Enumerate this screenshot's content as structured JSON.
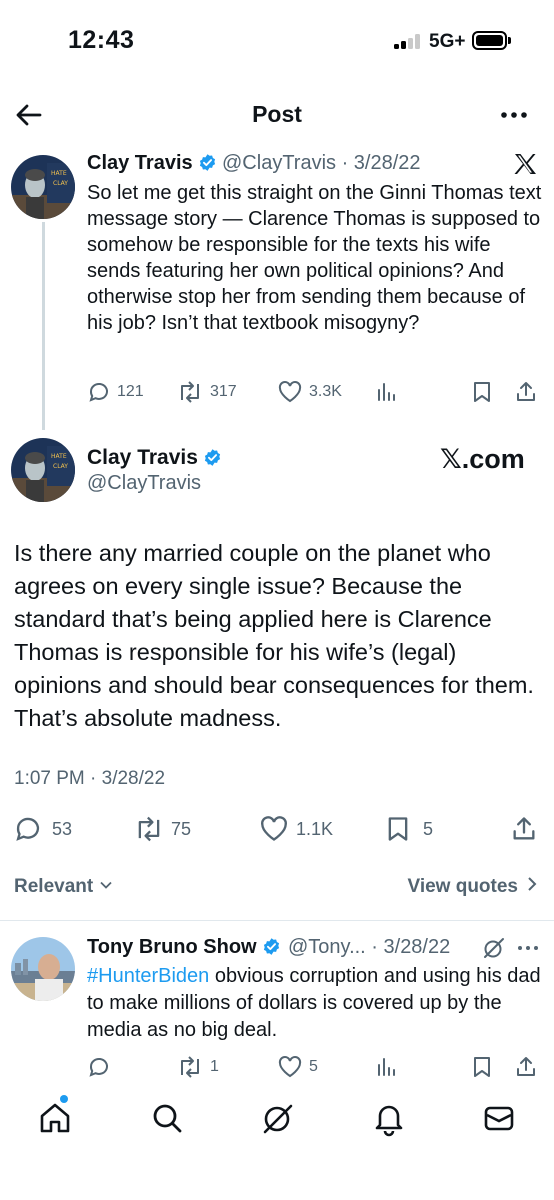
{
  "status": {
    "time": "12:43",
    "network": "5G+"
  },
  "header": {
    "title": "Post"
  },
  "quoted": {
    "name": "Clay Travis",
    "meta": "@ClayTravis · 3/28/22",
    "text": "So let me get this straight on the Ginni Thomas text message story — Clarence Thomas is supposed to somehow be responsible for the texts his wife sends featuring her own political opinions? And otherwise stop her from sending them because of his job? Isn’t that textbook misogyny?",
    "replies": "121",
    "reposts": "317",
    "likes": "3.3K",
    "avatar_text": "I HATE YOU CLAY TRAVIS"
  },
  "main": {
    "name": "Clay Travis",
    "handle": "@ClayTravis",
    "badge": "𝕏.com",
    "text": "Is there any married couple on the planet who agrees on every single issue? Because the standard that’s being applied here is Clarence Thomas is responsible for his wife’s (legal) opinions and should bear consequences for them. That’s absolute madness.",
    "timestamp": "1:07 PM · 3/28/22",
    "replies": "53",
    "reposts": "75",
    "likes": "1.1K",
    "bookmarks": "5"
  },
  "filters": {
    "sort": "Relevant",
    "quotes": "View quotes"
  },
  "reply": {
    "name": "Tony Bruno Show",
    "meta": "@Tony... · 3/28/22",
    "hashtag": "#HunterBiden",
    "text": " obvious corruption and using his dad to make millions of dollars is covered up by the media as no big deal.",
    "replies": "",
    "reposts": "1",
    "likes": "5"
  },
  "colors": {
    "accent": "#1d9bf0",
    "muted": "#536471",
    "text": "#0f1419"
  },
  "icons": [
    "back-arrow-icon",
    "more-icon",
    "verified-icon",
    "x-logo-icon",
    "reply-icon",
    "repost-icon",
    "like-icon",
    "views-icon",
    "bookmark-icon",
    "share-icon",
    "grok-icon",
    "home-icon",
    "search-icon",
    "notifications-icon",
    "messages-icon"
  ]
}
